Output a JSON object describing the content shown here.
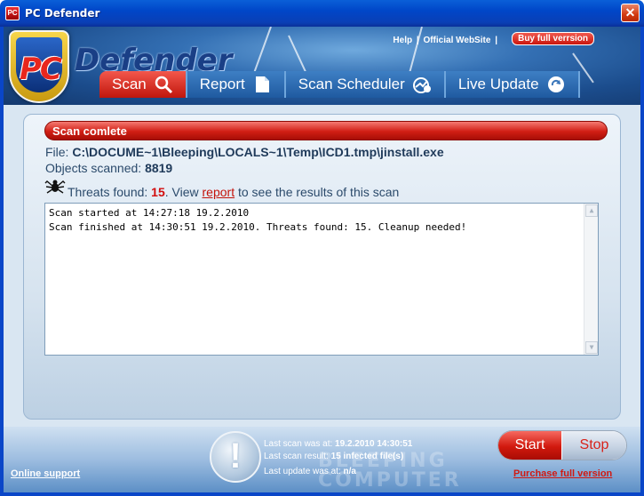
{
  "window": {
    "title": "PC Defender",
    "close_glyph": "✕",
    "app_icon_text": "PC"
  },
  "header": {
    "logo_initials": "PC",
    "logo_word": "Defender",
    "links": {
      "help": "Help",
      "separator": "|",
      "official_website": "Official WebSite",
      "separator2": "|"
    },
    "buy_button": "Buy full verrsion"
  },
  "tabs": [
    {
      "label": "Scan",
      "icon": "magnifier-icon",
      "active": true
    },
    {
      "label": "Report",
      "icon": "document-icon",
      "active": false
    },
    {
      "label": "Scan Scheduler",
      "icon": "scheduler-icon",
      "active": false
    },
    {
      "label": "Live Update",
      "icon": "update-icon",
      "active": false
    }
  ],
  "scan": {
    "status": "Scan comlete",
    "file_label": "File:",
    "file_path": "C:\\DOCUME~1\\Bleeping\\LOCALS~1\\Temp\\ICD1.tmp\\jinstall.exe",
    "objects_label": "Objects scanned:",
    "objects_count": "8819",
    "threats_label": "Threats found:",
    "threats_count": "15",
    "threats_suffix_1": ". View",
    "report_link": "report",
    "threats_suffix_2": "to see the results of this scan",
    "log": [
      "Scan started at 14:27:18 19.2.2010",
      "Scan finished at 14:30:51 19.2.2010. Threats found: 15. Cleanup needed!"
    ]
  },
  "footer": {
    "online_support": "Online support",
    "warning_glyph": "!",
    "last_scan_label": "Last scan was at:",
    "last_scan_value": "19.2.2010 14:30:51",
    "last_result_label": "Last scan result:",
    "last_result_value": "15 infected file(s)",
    "last_update_label": "Last update was at:",
    "last_update_value": "n/a",
    "start_button": "Start",
    "stop_button": "Stop",
    "purchase_link": "Purchase full version",
    "watermark_line1": "BLEEPING",
    "watermark_line2": "COMPUTER"
  },
  "colors": {
    "accent_red": "#d11e14",
    "title_blue": "#0a46c8",
    "header_blue": "#1b4c8c"
  }
}
